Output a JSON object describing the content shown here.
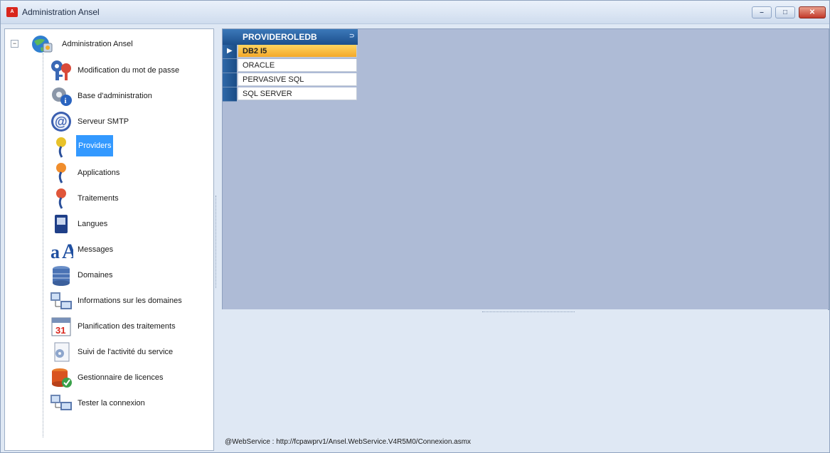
{
  "window": {
    "title": "Administration Ansel",
    "app_icon_text": "A",
    "buttons": {
      "minimize": "–",
      "maximize": "□",
      "close": "✕"
    }
  },
  "tree": {
    "root": {
      "label": "Administration Ansel",
      "icon": "globe-admin-icon",
      "expander": "−"
    },
    "items": [
      {
        "label": "Modification du mot de passe",
        "icon": "keys-icon"
      },
      {
        "label": "Base d'administration",
        "icon": "gear-info-icon"
      },
      {
        "label": "Serveur SMTP",
        "icon": "at-sign-icon"
      },
      {
        "label": "Providers",
        "icon": "provider-pin-icon",
        "selected": true
      },
      {
        "label": "Applications",
        "icon": "application-pin-icon"
      },
      {
        "label": "Traitements",
        "icon": "treatment-pin-icon"
      },
      {
        "label": "Langues",
        "icon": "language-book-icon"
      },
      {
        "label": "Messages",
        "icon": "message-letters-icon"
      },
      {
        "label": "Domaines",
        "icon": "database-stack-icon"
      },
      {
        "label": "Informations sur les domaines",
        "icon": "computer-network-icon"
      },
      {
        "label": "Planification des traitements",
        "icon": "calendar-icon"
      },
      {
        "label": "Suivi de l'activité du service",
        "icon": "activity-gear-icon"
      },
      {
        "label": "Gestionnaire de licences",
        "icon": "license-check-icon"
      },
      {
        "label": "Tester la connexion",
        "icon": "connection-test-icon"
      }
    ]
  },
  "grid": {
    "header": "PROVIDEROLEDB",
    "pin_glyph": "⊃",
    "rows": [
      {
        "value": "DB2 I5",
        "selected": true
      },
      {
        "value": "ORACLE"
      },
      {
        "value": "PERVASIVE SQL"
      },
      {
        "value": "SQL SERVER"
      }
    ],
    "current_row_glyph": "▶"
  },
  "status": {
    "text": "@WebService : http://fcpawprv1/Ansel.WebService.V4R5M0/Connexion.asmx"
  },
  "colors": {
    "titlebar": "#dbe6f4",
    "grid_background": "#aebbd6",
    "header_blue": "#1c4f8c",
    "selection_blue": "#3399ff",
    "selected_row": "#f4a82a",
    "close_red": "#c2392a"
  }
}
